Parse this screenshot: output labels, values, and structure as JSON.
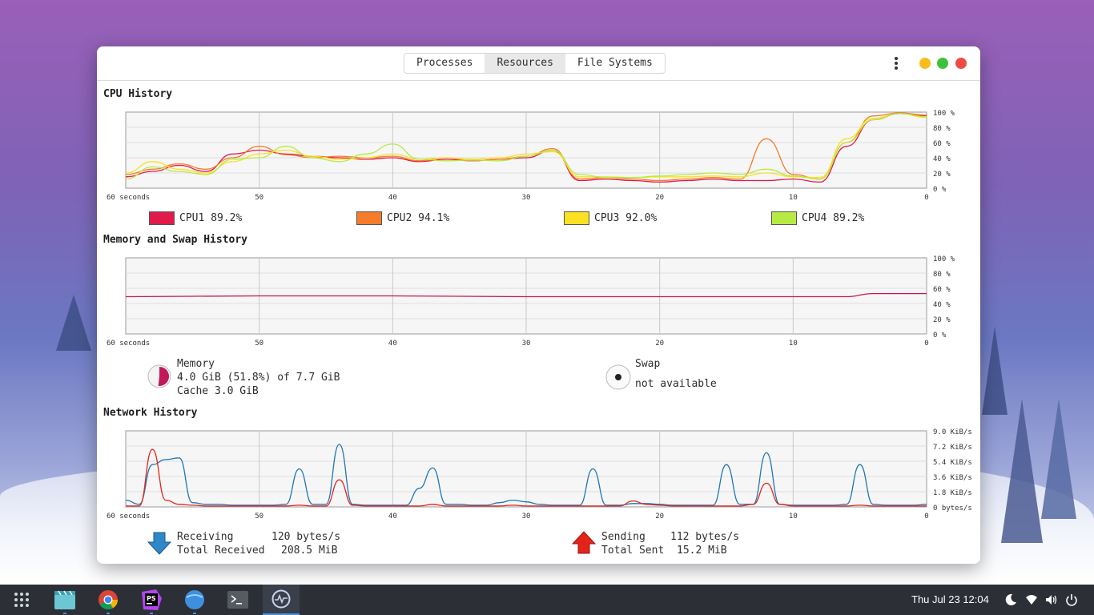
{
  "tabs": [
    {
      "label": "Processes",
      "active": false
    },
    {
      "label": "Resources",
      "active": true
    },
    {
      "label": "File Systems",
      "active": false
    }
  ],
  "window_buttons": {
    "minimize_color": "#f7bd1f",
    "maximize_color": "#3fc03f",
    "close_color": "#ef4b46"
  },
  "cpu": {
    "title": "CPU History",
    "x_label": "60 seconds",
    "x_ticks": [
      "50",
      "40",
      "30",
      "20",
      "10",
      "0"
    ],
    "y_ticks": [
      "100 %",
      "80 %",
      "60 %",
      "40 %",
      "20 %",
      "0 %"
    ],
    "legend": [
      {
        "label": "CPU1 89.2%",
        "color": "#e01b4b"
      },
      {
        "label": "CPU2 94.1%",
        "color": "#f57c2a"
      },
      {
        "label": "CPU3 92.0%",
        "color": "#fbe123"
      },
      {
        "label": "CPU4 89.2%",
        "color": "#b7ea42"
      }
    ]
  },
  "memory": {
    "title": "Memory and Swap History",
    "x_label": "60 seconds",
    "x_ticks": [
      "50",
      "40",
      "30",
      "20",
      "10",
      "0"
    ],
    "y_ticks": [
      "100 %",
      "80 %",
      "60 %",
      "40 %",
      "20 %",
      "0 %"
    ],
    "memory_label": "Memory",
    "memory_used": "4.0 GiB (51.8%) of 7.7 GiB",
    "memory_cache": "Cache 3.0 GiB",
    "memory_fraction": 0.518,
    "memory_color": "#c2185b",
    "swap_label": "Swap",
    "swap_status": "not available"
  },
  "network": {
    "title": "Network History",
    "x_label": "60 seconds",
    "x_ticks": [
      "50",
      "40",
      "30",
      "20",
      "10",
      "0"
    ],
    "y_ticks": [
      "9.0 KiB/s",
      "7.2 KiB/s",
      "5.4 KiB/s",
      "3.6 KiB/s",
      "1.8 KiB/s",
      "0 bytes/s"
    ],
    "receiving_label": "Receiving",
    "receiving_value": "120 bytes/s",
    "total_received_label": "Total Received",
    "total_received_value": "208.5 MiB",
    "sending_label": "Sending",
    "sending_value": "112 bytes/s",
    "total_sent_label": "Total Sent",
    "total_sent_value": "15.2 MiB",
    "receiving_color": "#1f77b4",
    "sending_color": "#e3241b"
  },
  "chart_data": [
    {
      "type": "line",
      "x": [
        60,
        58,
        56,
        54,
        52,
        50,
        48,
        46,
        44,
        42,
        40,
        38,
        36,
        34,
        32,
        30,
        28,
        26,
        24,
        22,
        20,
        18,
        16,
        14,
        12,
        10,
        8,
        6,
        4,
        2,
        0
      ],
      "xlim": [
        60,
        0
      ],
      "ylim": [
        0,
        100
      ],
      "series": [
        {
          "name": "CPU1",
          "values": [
            15,
            22,
            30,
            22,
            45,
            50,
            45,
            42,
            40,
            38,
            40,
            35,
            38,
            36,
            38,
            40,
            50,
            10,
            12,
            10,
            8,
            10,
            12,
            10,
            10,
            12,
            8,
            55,
            90,
            98,
            95
          ]
        },
        {
          "name": "CPU2",
          "values": [
            18,
            25,
            32,
            25,
            40,
            55,
            44,
            40,
            42,
            40,
            42,
            36,
            40,
            36,
            38,
            42,
            52,
            12,
            14,
            12,
            10,
            12,
            14,
            12,
            65,
            18,
            12,
            60,
            95,
            99,
            96
          ]
        },
        {
          "name": "CPU3",
          "values": [
            20,
            35,
            25,
            20,
            35,
            45,
            50,
            42,
            38,
            40,
            45,
            38,
            40,
            38,
            40,
            45,
            48,
            15,
            15,
            14,
            15,
            15,
            16,
            15,
            20,
            15,
            14,
            65,
            92,
            98,
            93
          ]
        },
        {
          "name": "CPU4",
          "values": [
            12,
            28,
            22,
            18,
            38,
            40,
            55,
            40,
            35,
            45,
            58,
            38,
            36,
            37,
            36,
            42,
            50,
            18,
            14,
            14,
            16,
            18,
            20,
            18,
            25,
            16,
            12,
            60,
            90,
            98,
            94
          ]
        }
      ]
    },
    {
      "type": "line",
      "x": [
        60,
        50,
        40,
        30,
        20,
        10,
        6,
        4,
        0
      ],
      "xlim": [
        60,
        0
      ],
      "ylim": [
        0,
        100
      ],
      "series": [
        {
          "name": "Memory",
          "values": [
            49,
            50,
            50,
            49,
            49,
            49,
            49,
            53,
            53
          ]
        }
      ]
    },
    {
      "type": "line",
      "x": [
        60,
        59,
        58,
        57,
        56,
        55,
        54,
        53,
        52,
        51,
        50,
        49,
        48,
        47,
        46,
        45,
        44,
        43,
        42,
        41,
        40,
        39,
        38,
        37,
        36,
        35,
        34,
        33,
        32,
        31,
        30,
        29,
        28,
        27,
        26,
        25,
        24,
        23,
        22,
        21,
        20,
        19,
        18,
        17,
        16,
        15,
        14,
        13,
        12,
        11,
        10,
        9,
        8,
        7,
        6,
        5,
        4,
        3,
        2,
        1,
        0
      ],
      "xlim": [
        60,
        0
      ],
      "ylim": [
        0,
        9.0
      ],
      "series": [
        {
          "name": "Receiving",
          "values": [
            0.8,
            0.3,
            5.0,
            5.6,
            5.8,
            0.5,
            0.3,
            0.3,
            0.2,
            0.2,
            0.2,
            0.2,
            0.3,
            4.5,
            0.3,
            0.3,
            7.4,
            0.3,
            0.2,
            0.2,
            0.2,
            0.2,
            2.2,
            4.6,
            0.3,
            0.3,
            0.2,
            0.2,
            0.5,
            0.8,
            0.6,
            0.3,
            0.2,
            0.2,
            0.2,
            4.5,
            0.2,
            0.2,
            0.4,
            0.4,
            0.3,
            0.2,
            0.2,
            0.2,
            0.2,
            5.0,
            0.3,
            0.3,
            6.4,
            0.3,
            0.2,
            0.2,
            0.2,
            0.2,
            0.3,
            5.0,
            0.3,
            0.2,
            0.2,
            0.2,
            0.3
          ]
        },
        {
          "name": "Sending",
          "values": [
            0.1,
            0.1,
            6.8,
            0.8,
            0.3,
            0.2,
            0.1,
            0.1,
            0.1,
            0.1,
            0.1,
            0.1,
            0.1,
            0.2,
            0.1,
            0.1,
            3.2,
            0.2,
            0.1,
            0.1,
            0.1,
            0.1,
            0.1,
            0.3,
            0.1,
            0.1,
            0.1,
            0.1,
            0.1,
            0.2,
            0.1,
            0.1,
            0.1,
            0.1,
            0.1,
            0.1,
            0.1,
            0.1,
            0.7,
            0.3,
            0.2,
            0.1,
            0.1,
            0.1,
            0.1,
            0.1,
            0.1,
            0.3,
            2.8,
            0.3,
            0.1,
            0.1,
            0.1,
            0.1,
            0.1,
            0.2,
            0.1,
            0.1,
            0.1,
            0.1,
            0.1
          ]
        }
      ]
    }
  ],
  "taskbar": {
    "apps": [
      {
        "name": "app-grid-icon"
      },
      {
        "name": "video-editor-icon"
      },
      {
        "name": "chrome-icon"
      },
      {
        "name": "phpstorm-icon"
      },
      {
        "name": "web-browser-icon"
      },
      {
        "name": "terminal-icon"
      },
      {
        "name": "system-monitor-icon"
      }
    ],
    "clock": "Thu Jul 23  12:04",
    "tray": [
      "night-mode-icon",
      "wifi-icon",
      "volume-icon",
      "power-icon"
    ],
    "ps_label": "PS"
  }
}
